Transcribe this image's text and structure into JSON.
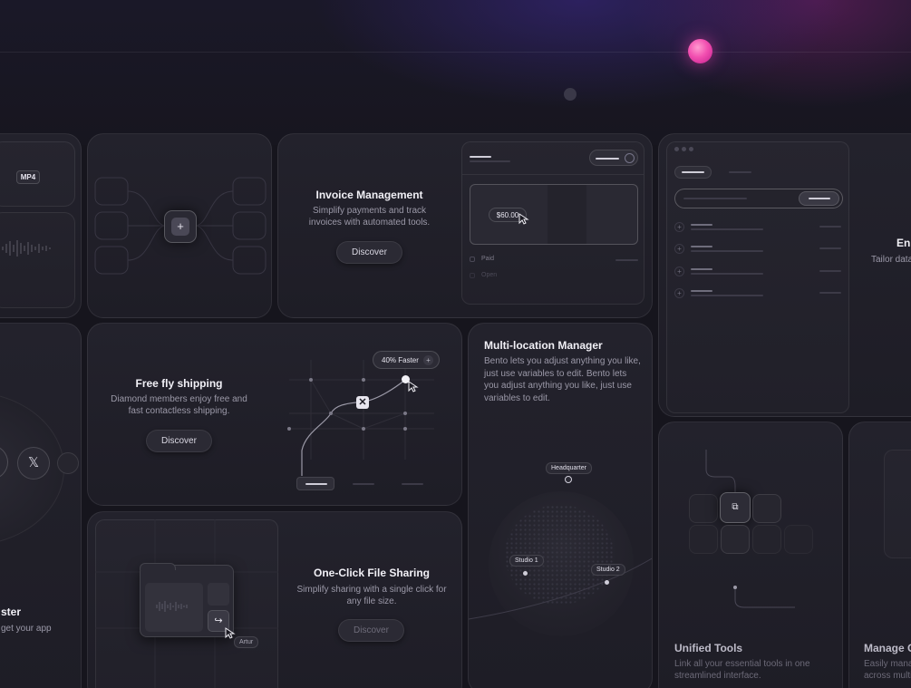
{
  "media": {
    "mp4_label": "MP4"
  },
  "invoice": {
    "title": "Invoice Management",
    "desc": "Simplify payments and track invoices with automated tools.",
    "button": "Discover",
    "amount": "$60.00",
    "status_paid": "Paid",
    "status_open": "Open"
  },
  "shipping": {
    "title": "Free fly shipping",
    "desc": "Diamond members enjoy free and fast contactless shipping.",
    "button": "Discover",
    "badge": "40% Faster"
  },
  "multilocation": {
    "title": "Multi-location Manager",
    "desc": "Bento lets you adjust anything you like, just use variables to edit. Bento lets you adjust anything you like, just use variables to edit.",
    "locations": [
      "Headquarter",
      "Studio 1",
      "Studio 2"
    ]
  },
  "enhance": {
    "title_partial": "Enh",
    "desc_partial": "Tailor data"
  },
  "integrations": {
    "x_icon_label": "𝕏"
  },
  "faster": {
    "title_partial": "ster",
    "desc_partial": "get your app"
  },
  "filesharing": {
    "title": "One-Click File Sharing",
    "desc": "Simplify sharing with a single click for any file size.",
    "button": "Discover",
    "cursor_name": "Artur"
  },
  "unified": {
    "title": "Unified Tools",
    "desc": "Link all your essential tools in one streamlined interface."
  },
  "manage": {
    "title_partial": "Manage C",
    "desc_line1": "Easily manag",
    "desc_line2": "across multi"
  },
  "colors": {
    "accent_orb": "#f24fb0",
    "background": "#16151d"
  }
}
